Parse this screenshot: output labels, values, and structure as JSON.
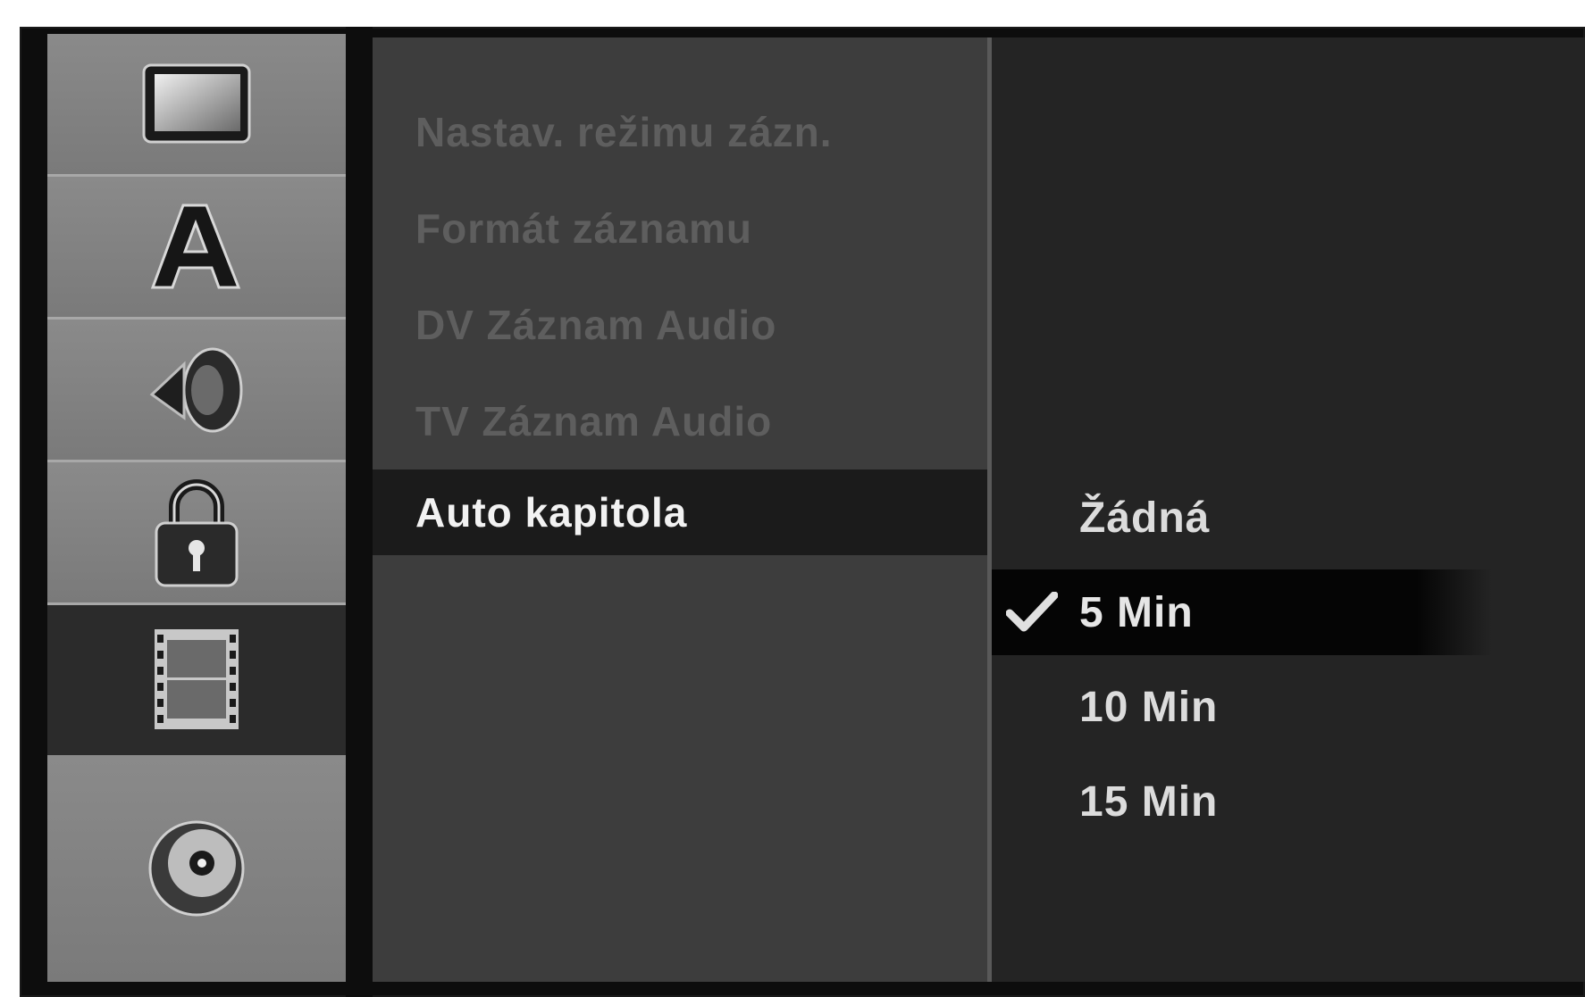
{
  "sidebar": {
    "items": [
      {
        "icon": "display-icon",
        "active": false
      },
      {
        "icon": "language-icon",
        "active": false
      },
      {
        "icon": "speaker-icon",
        "active": false
      },
      {
        "icon": "lock-icon",
        "active": false
      },
      {
        "icon": "film-icon",
        "active": true
      },
      {
        "icon": "disc-icon",
        "active": false
      }
    ]
  },
  "menu": {
    "items": [
      {
        "label": "Nastav. režimu zázn."
      },
      {
        "label": "Formát záznamu"
      },
      {
        "label": "DV Záznam Audio"
      },
      {
        "label": "TV Záznam Audio"
      },
      {
        "label": "Auto kapitola"
      }
    ],
    "active_index": 4
  },
  "options": {
    "items": [
      {
        "label": "Žádná",
        "checked": false
      },
      {
        "label": "5 Min",
        "checked": true
      },
      {
        "label": "10 Min",
        "checked": false
      },
      {
        "label": "15 Min",
        "checked": false
      }
    ],
    "check_glyph": "✔"
  }
}
